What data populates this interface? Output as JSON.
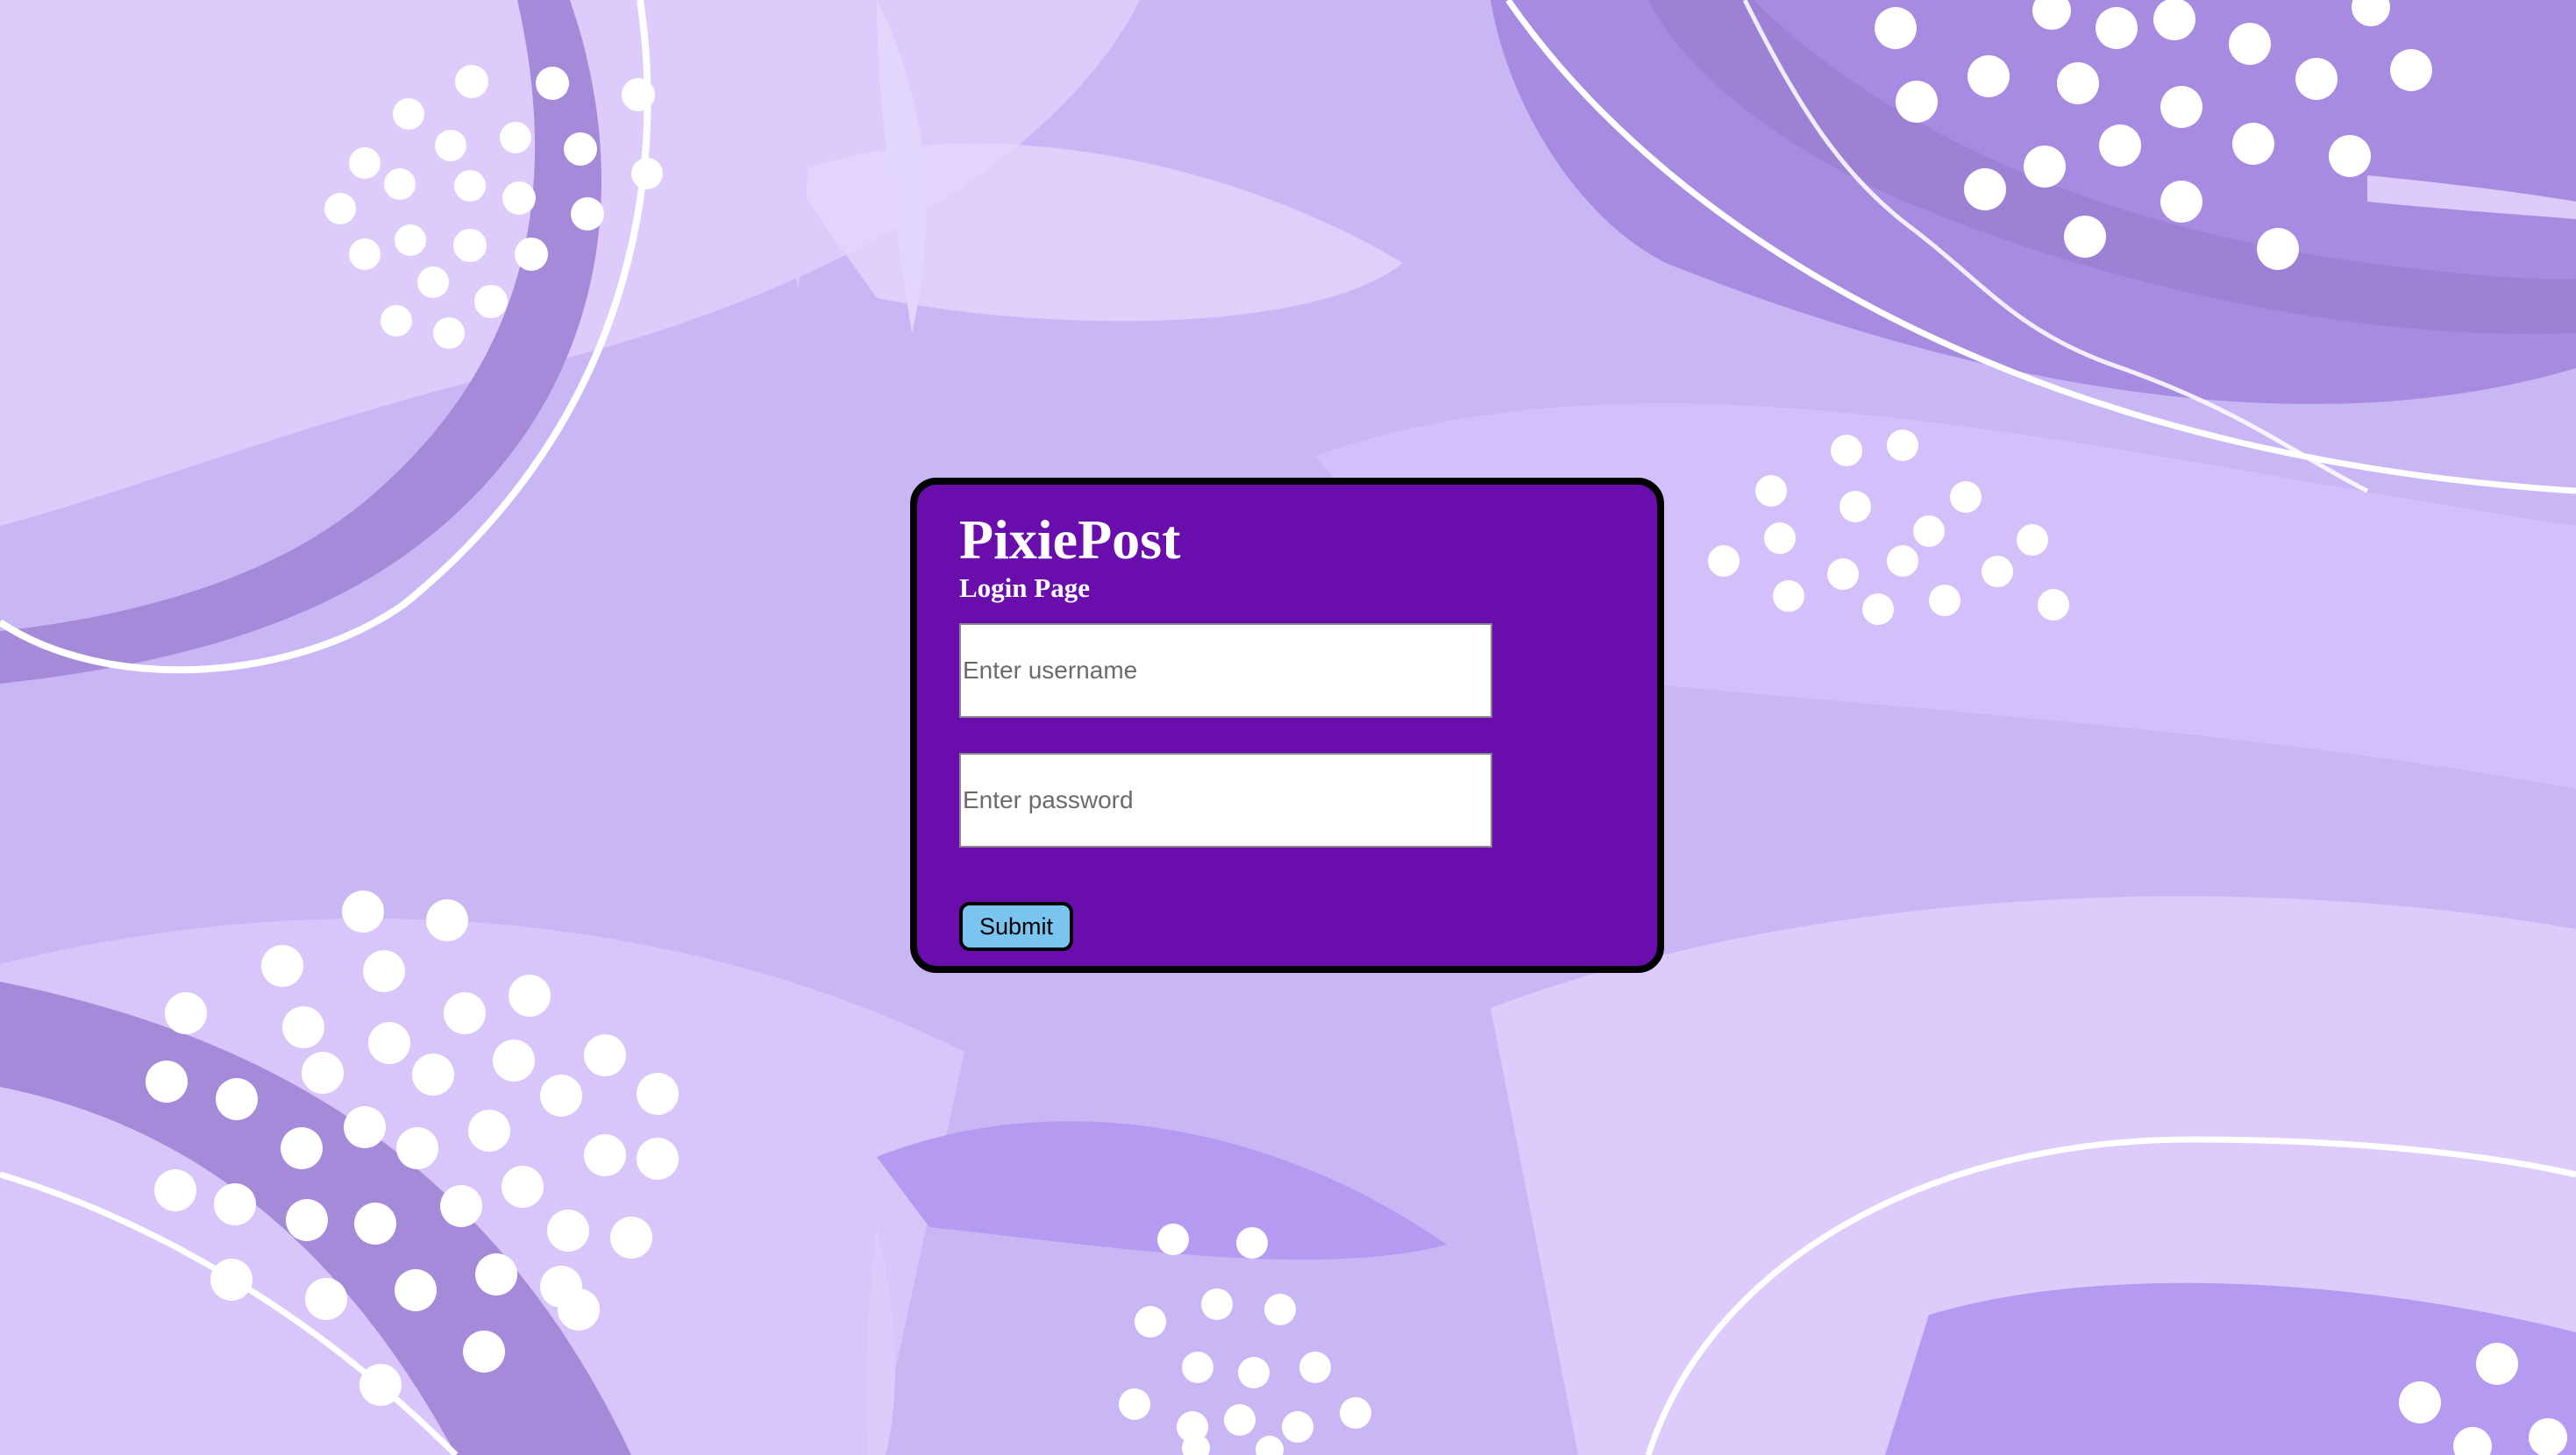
{
  "app": {
    "title": "PixiePost",
    "subtitle": "Login Page"
  },
  "form": {
    "username_placeholder": "Enter username",
    "username_value": "",
    "password_placeholder": "Enter password",
    "password_value": "",
    "submit_label": "Submit"
  },
  "colors": {
    "card_background": "#6a0dad",
    "card_border": "#000000",
    "button_background": "#7ac4f0",
    "page_background": "#c9b6f5",
    "accent_light": "#dccbfb",
    "accent_dark": "#a48ad9"
  }
}
